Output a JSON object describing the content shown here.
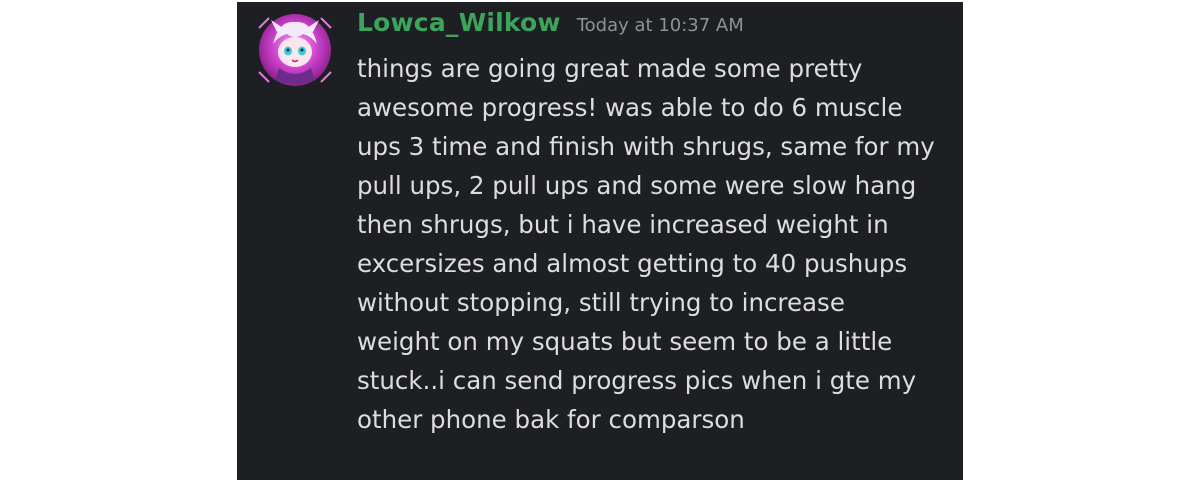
{
  "message": {
    "username": "Lowca_Wilkow",
    "username_color": "#3ba55c",
    "timestamp": "Today at 10:37 AM",
    "text": "things are going great made some pretty\nawesome progress! was able to do 6 muscle\nups 3 time and finish with shrugs, same for my\npull ups, 2 pull ups and some were slow hang\nthen shrugs, but i have increased weight in\nexcersizes and almost getting to 40 pushups\nwithout stopping, still trying to increase\nweight on my squats but seem to be a little\nstuck..i can send progress pics when i gte my\nother phone bak for comparson",
    "avatar_icon": "anime-avatar-icon"
  },
  "colors": {
    "background": "#1e1f22",
    "text": "#dcdde0",
    "timestamp": "#8e9297",
    "avatar_accent": "#d65ad6"
  }
}
